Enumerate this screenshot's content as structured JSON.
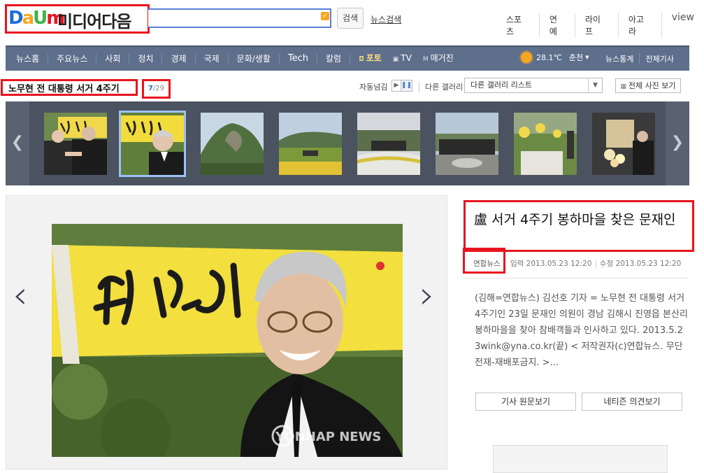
{
  "header": {
    "logo": {
      "d": "D",
      "a": "a",
      "u": "U",
      "m": "m"
    },
    "brand": "미디어다음",
    "search": {
      "value": "",
      "placeholder": ""
    },
    "search_button": "검색",
    "news_search": "뉴스검색",
    "top_links": [
      "스포츠",
      "연예",
      "라이프",
      "아고라",
      "view"
    ]
  },
  "nav": {
    "items": [
      "뉴스홈",
      "주요뉴스",
      "사회",
      "정치",
      "경제",
      "국제",
      "문화/생활",
      "Tech",
      "칼럼",
      "포토",
      "TV",
      "매거진"
    ],
    "icons": {
      "photo": "camera-icon",
      "tv": "tv-icon",
      "magazine": "m-icon"
    },
    "weather": {
      "temp": "28.1℃",
      "city": "춘천"
    },
    "right_links": [
      "뉴스통계",
      "전체기사"
    ]
  },
  "gallery": {
    "title": "노무현 전 대통령 서거 4주기",
    "current": "7",
    "total": "/29",
    "autoplay_label": "자동넘김",
    "other_gallery_label": "다른 갤러리",
    "select_value": "다른 갤러리 리스트",
    "all_photos_button": "전체 사진 보기",
    "thumbnails": [
      "thumb-1",
      "thumb-2",
      "thumb-3",
      "thumb-4",
      "thumb-5",
      "thumb-6",
      "thumb-7",
      "thumb-8"
    ],
    "active_index": 1
  },
  "photo": {
    "watermark": "YONHAP NEWS",
    "banner_text": "故노무현"
  },
  "article": {
    "headline": "盧 서거 4주기 봉하마을 찾은 문재인",
    "source": "연합뉴스",
    "input_label": "입력 2013.05.23 12:20",
    "modified_label": "수정 2013.05.23 12:20",
    "summary": "(김해=연합뉴스) 김선호 기자 = 노무현 전 대통령 서거 4주기인 23일 문재인 의원이 경남 김해시 진영읍 본산리 봉하마을을 찾아 참배객들과 인사하고 있다. 2013.5.23wink@yna.co.kr(끝) < 저작권자(c)연합뉴스. 무단전재-재배포금지. >...",
    "button_original": "기사 원문보기",
    "button_comments": "네티즌 의견보기"
  },
  "colors": {
    "nav": "#5e6f8c",
    "strip": "#4b5260",
    "highlight": "#e8141f",
    "accent": "#1c6cd9"
  }
}
